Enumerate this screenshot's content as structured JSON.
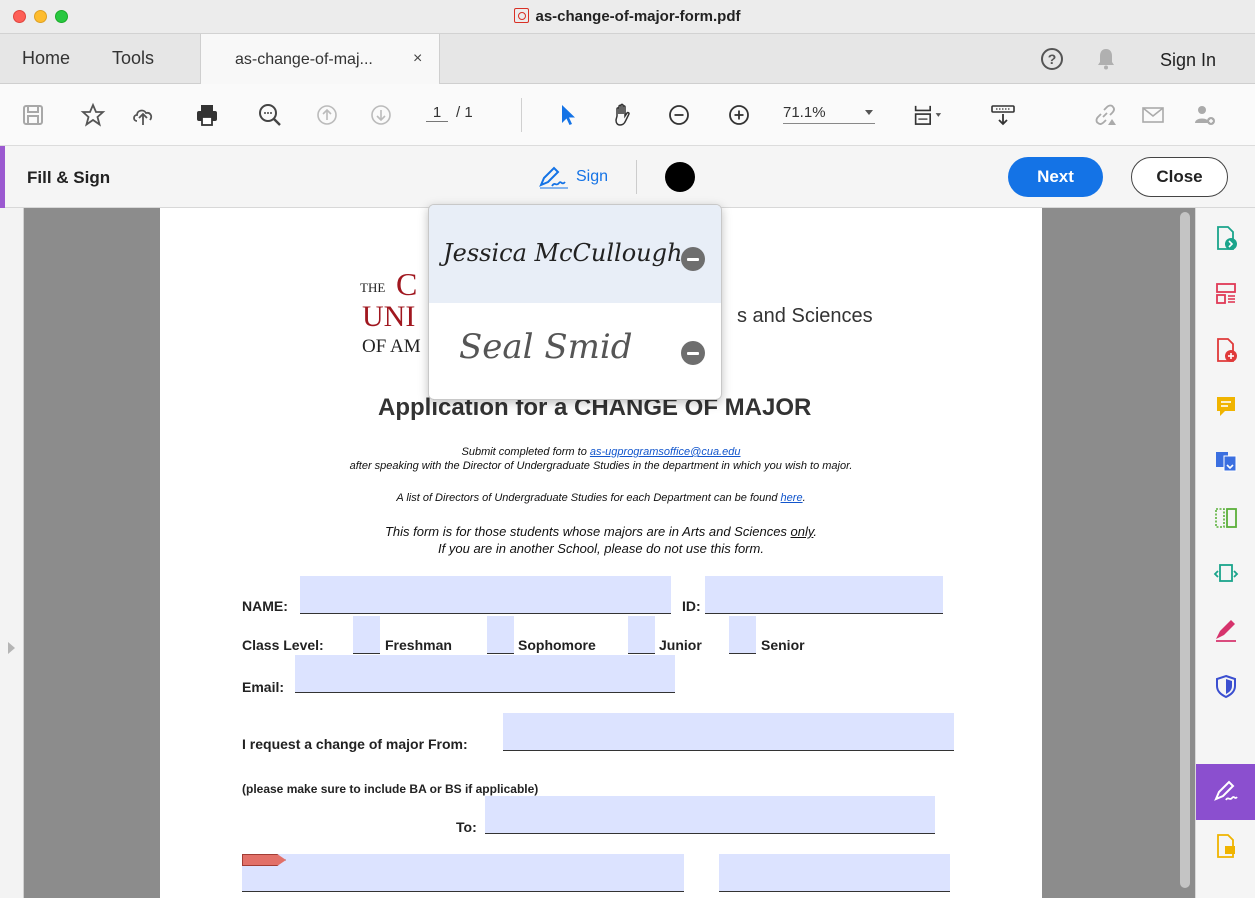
{
  "window": {
    "title": "as-change-of-major-form.pdf"
  },
  "tabs": {
    "home": "Home",
    "tools": "Tools",
    "document": "as-change-of-maj...",
    "close_glyph": "×"
  },
  "header": {
    "help_glyph": "?",
    "sign_in": "Sign In"
  },
  "toolbar": {
    "page_current": "1",
    "page_total": "/ 1",
    "zoom": "71.1%"
  },
  "fill_sign": {
    "title": "Fill & Sign",
    "sign_label": "Sign",
    "next_label": "Next",
    "close_label": "Close",
    "ink_color": "#000000"
  },
  "signatures": [
    {
      "text": "Jessica McCullough"
    },
    {
      "text": "Seal Smid"
    }
  ],
  "document": {
    "logo_the": "THE",
    "logo_line1": "C",
    "logo_line2": "UNI",
    "logo_line3": "OF AM",
    "college": "s and Sciences",
    "heading": "Application for a CHANGE OF MAJOR",
    "submit_prefix": "Submit completed form to ",
    "submit_email": "as-ugprogramsoffice@cua.edu",
    "submit_line2": "after speaking with the Director of Undergraduate Studies in the department in which you wish to major.",
    "directors_text": "A list of Directors of Undergraduate Studies for each Department can be found ",
    "directors_link": "here",
    "directors_end": ".",
    "notice_line1_prefix": "This form is for those students whose majors are in Arts and Sciences ",
    "notice_line1_only": "only",
    "notice_line1_end": ".",
    "notice_line2": "If you are in another School, please do not use this form.",
    "name_label": "NAME:",
    "id_label": "ID:",
    "class_level_label": "Class Level:",
    "class_options": [
      "Freshman",
      "Sophomore",
      "Junior",
      "Senior"
    ],
    "email_label": "Email:",
    "from_label": "I request a change of major From:",
    "note_label": "(please make sure to include BA or BS if applicable)",
    "to_label": "To:"
  },
  "colors": {
    "accent_blue": "#1473e6",
    "fill_sign_purple": "#8b4fcf",
    "field_fill": "#dce3ff",
    "logo_red": "#a0171f"
  }
}
